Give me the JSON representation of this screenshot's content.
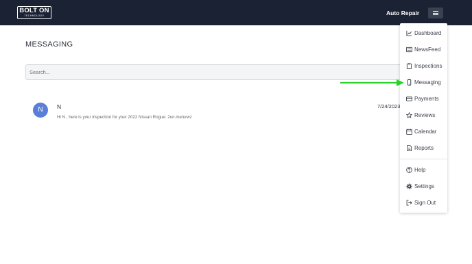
{
  "header": {
    "logo_main": "BOLT ON",
    "logo_sub": "TECHNOLOGY",
    "shop_name": "Auto Repair"
  },
  "page": {
    "title": "MESSAGING"
  },
  "search": {
    "placeholder": "Search..."
  },
  "messages": [
    {
      "avatar_initial": "N",
      "name": "N",
      "date": "7/24/2023",
      "preview": "Hi N , here is your inspection for your 2022 Nissan Rogue: 2un.me/urwz"
    }
  ],
  "menu": {
    "items": [
      {
        "label": "Dashboard",
        "icon": "chart-line-icon"
      },
      {
        "label": "NewsFeed",
        "icon": "newspaper-icon"
      },
      {
        "label": "Inspections",
        "icon": "clipboard-icon"
      },
      {
        "label": "Messaging",
        "icon": "mobile-phone-icon"
      },
      {
        "label": "Payments",
        "icon": "credit-card-icon"
      },
      {
        "label": "Reviews",
        "icon": "star-icon"
      },
      {
        "label": "Calendar",
        "icon": "calendar-icon"
      },
      {
        "label": "Reports",
        "icon": "file-report-icon"
      },
      {
        "label": "Help",
        "icon": "question-circle-icon"
      },
      {
        "label": "Settings",
        "icon": "gear-icon"
      },
      {
        "label": "Sign Out",
        "icon": "sign-out-icon"
      }
    ]
  },
  "annotation": {
    "arrow_color": "#27d12a",
    "points_to": "Messaging"
  },
  "colors": {
    "topbar": "#1b2233",
    "avatar": "#5b7fd8"
  }
}
